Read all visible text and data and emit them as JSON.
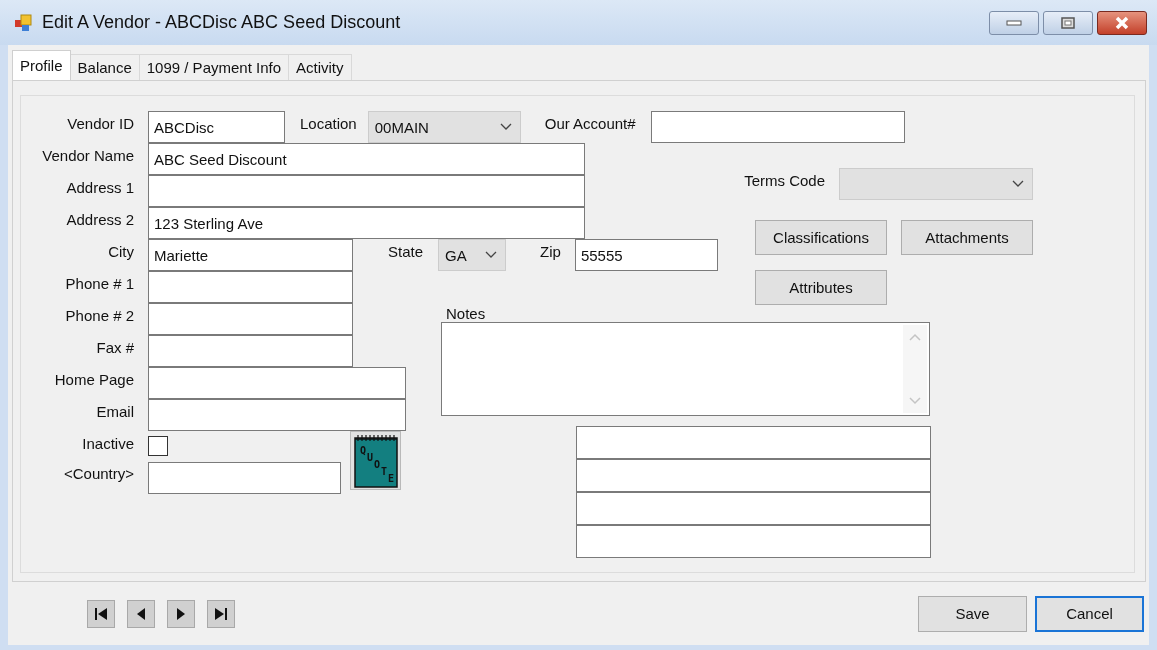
{
  "window": {
    "title": "Edit A Vendor - ABCDisc ABC Seed Discount"
  },
  "tabs": [
    {
      "label": "Profile",
      "selected": true
    },
    {
      "label": "Balance",
      "selected": false
    },
    {
      "label": "1099 / Payment Info",
      "selected": false
    },
    {
      "label": "Activity",
      "selected": false
    }
  ],
  "form": {
    "vendor_id": {
      "label": "Vendor ID",
      "value": "ABCDisc"
    },
    "location": {
      "label": "Location",
      "value": "00MAIN",
      "disabled": true
    },
    "our_account": {
      "label": "Our Account#"
    },
    "vendor_name": {
      "label": "Vendor Name",
      "value": "ABC Seed Discount"
    },
    "address_1": {
      "label": "Address 1"
    },
    "terms_code": {
      "label": "Terms Code",
      "disabled": true
    },
    "address_2": {
      "label": "Address 2",
      "value": "123 Sterling Ave"
    },
    "city": {
      "label": "City",
      "value": "Mariette"
    },
    "state": {
      "label": "State",
      "value": "GA",
      "disabled": true
    },
    "zip": {
      "label": "Zip",
      "value": "55555"
    },
    "phone_1": {
      "label": "Phone # 1"
    },
    "phone_2": {
      "label": "Phone # 2"
    },
    "fax": {
      "label": "Fax #"
    },
    "home_page": {
      "label": "Home Page"
    },
    "email": {
      "label": "Email"
    },
    "notes": {
      "label": "Notes"
    },
    "inactive": {
      "label": "Inactive",
      "checked": false
    },
    "country": {
      "label": "<Country>"
    },
    "quote_icon_text": "QUOTE"
  },
  "side_buttons": [
    "Classifications",
    "Attachments",
    "Attributes"
  ],
  "buttons": [
    {
      "label": "Save",
      "focused": false
    },
    {
      "label": "Cancel",
      "focused": true
    }
  ]
}
